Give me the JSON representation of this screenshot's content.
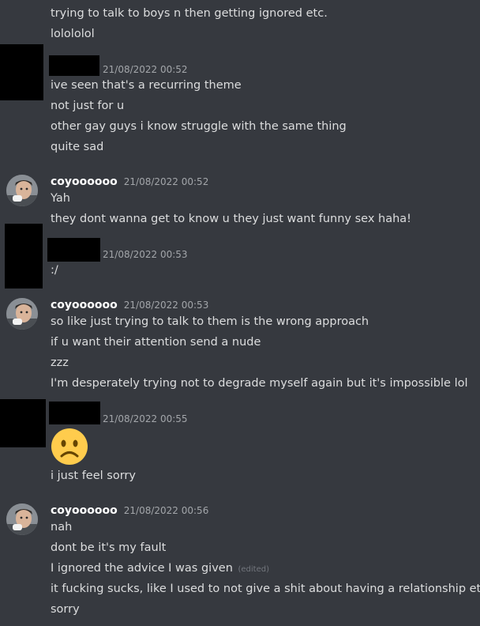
{
  "messages": [
    {
      "lines": [
        "trying to talk to boys n then getting ignored etc.",
        "lolololol"
      ]
    },
    {
      "author": "",
      "timestamp": "21/08/2022 00:52",
      "lines": [
        "ive seen that's a recurring theme",
        "not just for u",
        "other gay guys i know struggle with the same thing",
        "quite sad"
      ]
    },
    {
      "author": "coyoooooo",
      "timestamp": "21/08/2022 00:52",
      "lines": [
        "Yah",
        "they dont wanna get to know u they just want funny sex haha!"
      ]
    },
    {
      "author": "",
      "timestamp": "21/08/2022 00:53",
      "lines": [
        ":/"
      ]
    },
    {
      "author": "coyoooooo",
      "timestamp": "21/08/2022 00:53",
      "lines": [
        "so like just trying to talk to them is the wrong approach",
        "if u want their attention send a nude",
        "zzz",
        "I'm desperately trying not to degrade myself again but it's impossible lol"
      ]
    },
    {
      "author": "",
      "timestamp": "21/08/2022 00:55",
      "emoji": "frowning-face-emoji",
      "lines": [
        "i just feel sorry"
      ]
    },
    {
      "author": "coyoooooo",
      "timestamp": "21/08/2022 00:56",
      "lines": [
        "nah",
        "dont be it's my fault",
        "I ignored the advice I was given",
        "it fucking sucks, like I used to not give a shit about having a relationship etc",
        "sorry"
      ],
      "edited_label": "(edited)"
    }
  ],
  "colors": {
    "background": "#36393f",
    "text": "#dcddde",
    "username": "#ffffff",
    "timestamp": "#a3a6aa",
    "redaction": "#000000",
    "emoji_face": "#ffcc4d"
  },
  "icons": {
    "emoji": "frowning-face-emoji",
    "avatar": "user-avatar"
  }
}
